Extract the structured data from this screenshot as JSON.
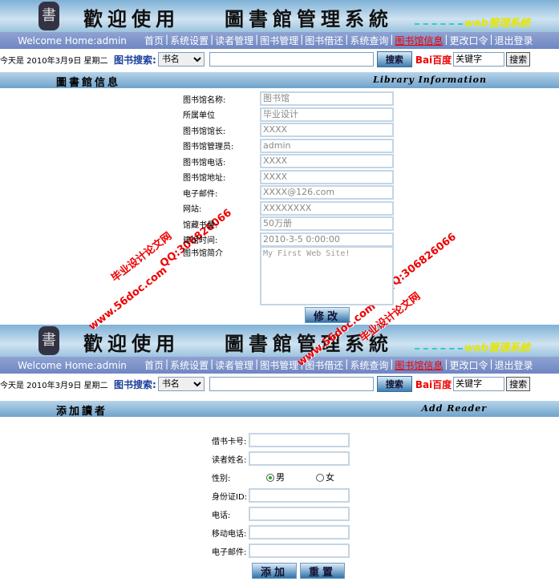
{
  "banner": {
    "logo": "書",
    "title_a": "歡迎使用",
    "title_b": "圖書館管理系統",
    "subtitle": "web管理系統"
  },
  "nav": {
    "welcome": "Welcome Home:admin",
    "links": [
      "首页",
      "系统设置",
      "读者管理",
      "图书管理",
      "图书借还",
      "系统查询",
      "图书馆信息",
      "更改口令",
      "退出登录"
    ],
    "active_index": 6
  },
  "search": {
    "date": "今天是 2010年3月9日 星期二",
    "label": "图书搜索:",
    "select_value": "书名",
    "button": "搜索",
    "baidu": "Bai百度",
    "baidu_value": "关键字",
    "baidu_button": "搜索"
  },
  "library": {
    "section_cn": "圖書館信息",
    "section_en": "Library  Information",
    "fields": [
      {
        "label": "图书馆名称:",
        "value": "图书馆"
      },
      {
        "label": "所属单位",
        "value": "毕业设计"
      },
      {
        "label": "图书馆馆长:",
        "value": "XXXX"
      },
      {
        "label": "图书馆管理员:",
        "value": "admin"
      },
      {
        "label": "图书馆电话:",
        "value": "XXXX"
      },
      {
        "label": "图书馆地址:",
        "value": "XXXX"
      },
      {
        "label": "电子邮件:",
        "value": "XXXX@126.com"
      },
      {
        "label": "网站:",
        "value": "XXXXXXXX"
      },
      {
        "label": "馆藏书量:",
        "value": "50万册"
      },
      {
        "label": "建馆时间:",
        "value": "2010-3-5 0:00:00"
      }
    ],
    "intro_label": "图书馆简介",
    "intro_value": "My First Web Site!",
    "submit": "修改"
  },
  "reader": {
    "section_cn": "添加讀者",
    "section_en": "Add  Reader",
    "fields_a": [
      {
        "label": "借书卡号:",
        "value": ""
      },
      {
        "label": "读者姓名:",
        "value": ""
      }
    ],
    "gender_label": "性别:",
    "male": "男",
    "female": "女",
    "gender_selected": "男",
    "fields_b": [
      {
        "label": "身份证ID:",
        "value": ""
      },
      {
        "label": "电话:",
        "value": ""
      },
      {
        "label": "移动电话:",
        "value": ""
      },
      {
        "label": "电子邮件:",
        "value": ""
      }
    ],
    "add": "添加",
    "reset": "重置"
  },
  "watermarks": {
    "site": "毕业设计论文网",
    "url": "www.56doc.com",
    "qq": "QQ:306826066"
  },
  "colors": {
    "nav": "#7a8fc8",
    "active_link": "#e00000",
    "watermark": "#e00000"
  }
}
